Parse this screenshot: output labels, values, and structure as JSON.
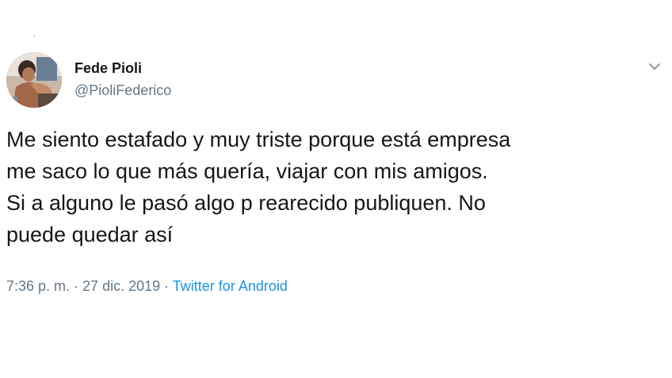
{
  "tweet": {
    "author": {
      "name": "Fede Pioli",
      "handle": "@PioliFederico",
      "avatar_icon": "profile-photo"
    },
    "text_lines": [
      "Me siento estafado y muy triste porque está empresa",
      "me saco lo que más quería, viajar con mis amigos.",
      "Si a alguno le pasó algo p rearecido publiquen. No",
      "puede quedar así"
    ],
    "meta": {
      "time": "7:36 p. m.",
      "separator_1": " · ",
      "date": "27 dic. 2019",
      "separator_2": " · ",
      "source": "Twitter for Android"
    },
    "menu_icon": "chevron-down-icon"
  },
  "colors": {
    "text_primary": "#14171a",
    "text_secondary": "#657786",
    "link": "#1b95e0",
    "background": "#ffffff"
  }
}
